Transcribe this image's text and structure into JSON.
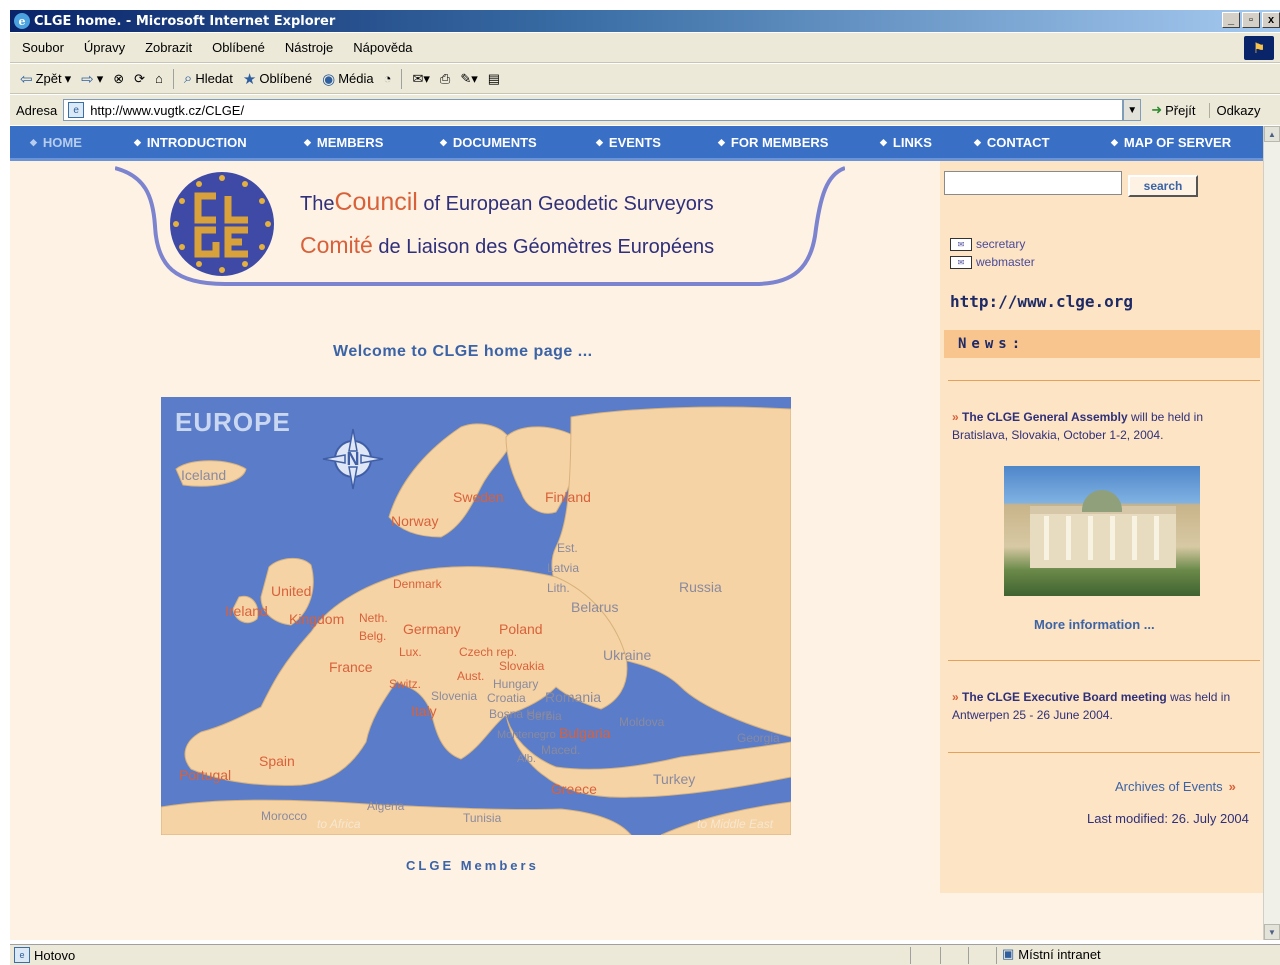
{
  "window": {
    "title": "CLGE home. - Microsoft Internet Explorer"
  },
  "menu": {
    "items": [
      "Soubor",
      "Úpravy",
      "Zobrazit",
      "Oblíbené",
      "Nástroje",
      "Nápověda"
    ]
  },
  "toolbar": {
    "back": "Zpět",
    "search": "Hledat",
    "favorites": "Oblíbené",
    "media": "Média"
  },
  "address": {
    "label": "Adresa",
    "url": "http://www.vugtk.cz/CLGE/",
    "go": "Přejít",
    "links": "Odkazy"
  },
  "nav": {
    "items": [
      "HOME",
      "INTRODUCTION",
      "MEMBERS",
      "DOCUMENTS",
      "EVENTS",
      "FOR MEMBERS",
      "LINKS",
      "CONTACT",
      "MAP OF SERVER"
    ]
  },
  "header": {
    "line1_pre": "The",
    "line1_big": "Council",
    "line1_rest": "of  European Geodetic Surveyors",
    "line2_big": "Comité",
    "line2_rest": "de Liaison   des  Géomètres Européens",
    "logo_letters": "CLGE"
  },
  "main": {
    "welcome": "Welcome to CLGE home page ...",
    "members_link": "CLGE  Members"
  },
  "map": {
    "title": "EUROPE",
    "compass_letter": "N",
    "labels": [
      "Iceland",
      "Sweden",
      "Finland",
      "Norway",
      "Est.",
      "Latvia",
      "Lith.",
      "Russia",
      "Denmark",
      "United",
      "Kingdom",
      "Ireland",
      "Neth.",
      "Belg.",
      "Germany",
      "Poland",
      "Belarus",
      "Lux.",
      "Czech rep.",
      "Slovakia",
      "Ukraine",
      "France",
      "Aust.",
      "Hungary",
      "Switz.",
      "Slovenia",
      "Croatia",
      "Romania",
      "Bosna Herz.",
      "Serbia",
      "Moldova",
      "Italy",
      "Montenegro",
      "Bulgaria",
      "Maced.",
      "Alb.",
      "Spain",
      "Portugal",
      "Greece",
      "Turkey",
      "Georgia",
      "Morocco",
      "Algeria",
      "Tunisia",
      "to Africa",
      "to Middle East"
    ]
  },
  "sidebar": {
    "search_button": "search",
    "search_value": "",
    "contacts": [
      "secretary",
      "webmaster"
    ],
    "site_url": "http://www.clge.org",
    "news_heading": "News:",
    "news": [
      {
        "headline": "The CLGE General Assembly",
        "text": " will be held in Bratislava, Slovakia, October 1-2, 2004."
      },
      {
        "headline": "The CLGE Executive Board meeting",
        "text": " was held in Antwerpen 25 - 26 June 2004."
      }
    ],
    "more_info": "More information ...",
    "archives": "Archives of Events",
    "last_modified": "Last modified: 26. July 2004"
  },
  "status": {
    "text": "Hotovo",
    "zone": "Místní intranet"
  },
  "colors": {
    "nav": "#3a6fc6",
    "accent": "#d9613a",
    "panel": "#fde4c4",
    "page": "#fdf2e4",
    "sea": "#5a7cc9",
    "land": "#f6d3a5"
  }
}
